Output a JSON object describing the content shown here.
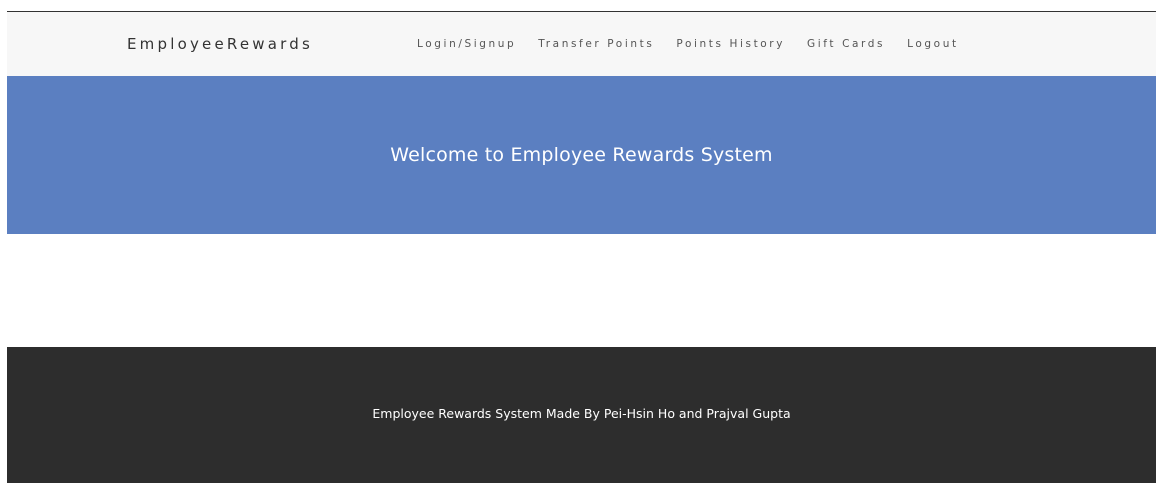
{
  "navbar": {
    "brand": "EmployeeRewards",
    "links": [
      {
        "label": "Login/Signup"
      },
      {
        "label": "Transfer Points"
      },
      {
        "label": "Points History"
      },
      {
        "label": "Gift Cards"
      },
      {
        "label": "Logout"
      }
    ]
  },
  "hero": {
    "title": "Welcome to Employee Rewards System"
  },
  "footer": {
    "text": "Employee Rewards System Made By Pei-Hsin Ho and Prajval Gupta"
  },
  "colors": {
    "navbar_bg": "#f7f7f7",
    "hero_bg": "#5b7fc1",
    "footer_bg": "#2d2d2d"
  }
}
